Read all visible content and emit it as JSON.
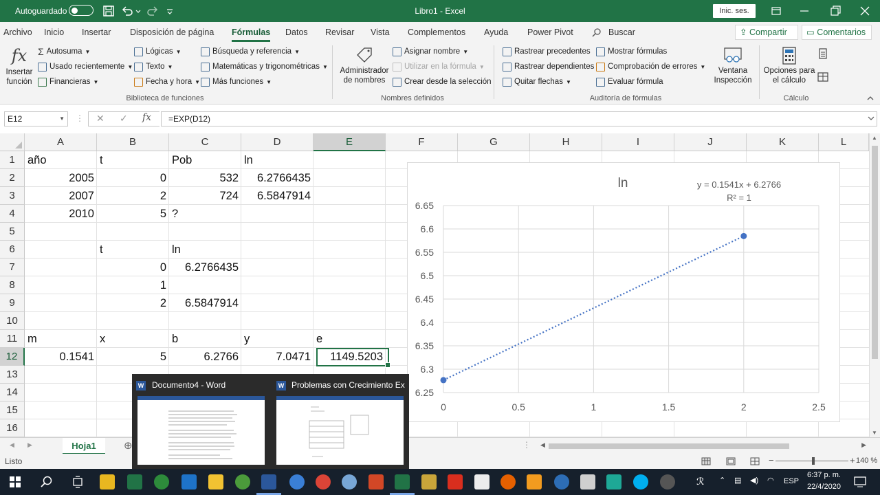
{
  "titlebar": {
    "autosave_label": "Autoguardado",
    "title": "Libro1 - Excel",
    "signin_label": "Inic. ses."
  },
  "ribbon_tabs": [
    "Archivo",
    "Inicio",
    "Insertar",
    "Disposición de página",
    "Fórmulas",
    "Datos",
    "Revisar",
    "Vista",
    "Complementos",
    "Ayuda",
    "Power Pivot"
  ],
  "search_label": "Buscar",
  "share_label": "Compartir",
  "comments_label": "Comentarios",
  "ribbon": {
    "insert_function": "Insertar\nfunción",
    "autosum": "Autosuma",
    "recent": "Usado recientemente",
    "financial": "Financieras",
    "logical": "Lógicas",
    "text": "Texto",
    "datetime": "Fecha y hora",
    "lookup": "Búsqueda y referencia",
    "math": "Matemáticas y trigonométricas",
    "more": "Más funciones",
    "group_library": "Biblioteca de funciones",
    "name_manager": "Administrador\nde nombres",
    "define_name": "Asignar nombre",
    "use_in_formula": "Utilizar en la fórmula",
    "create_from_selection": "Crear desde la selección",
    "group_names": "Nombres definidos",
    "trace_precedents": "Rastrear precedentes",
    "trace_dependents": "Rastrear dependientes",
    "remove_arrows": "Quitar flechas",
    "show_formulas": "Mostrar fórmulas",
    "error_checking": "Comprobación de errores",
    "evaluate_formula": "Evaluar fórmula",
    "watch_window": "Ventana\nInspección",
    "group_audit": "Auditoría de fórmulas",
    "calc_options": "Opciones para\nel cálculo",
    "group_calc": "Cálculo"
  },
  "formula_bar": {
    "name_box": "E12",
    "formula": "=EXP(D12)"
  },
  "columns": [
    "A",
    "B",
    "C",
    "D",
    "E",
    "F",
    "G",
    "H",
    "I",
    "J",
    "K",
    "L"
  ],
  "rows": [
    "1",
    "2",
    "3",
    "4",
    "5",
    "6",
    "7",
    "8",
    "9",
    "10",
    "11",
    "12",
    "13",
    "14",
    "15",
    "16"
  ],
  "cells": [
    {
      "ref": "A1",
      "v": "año"
    },
    {
      "ref": "B1",
      "v": "t"
    },
    {
      "ref": "C1",
      "v": "Pob"
    },
    {
      "ref": "D1",
      "v": "ln"
    },
    {
      "ref": "A2",
      "v": "2005"
    },
    {
      "ref": "B2",
      "v": "0"
    },
    {
      "ref": "C2",
      "v": "532"
    },
    {
      "ref": "D2",
      "v": "6.2766435"
    },
    {
      "ref": "A3",
      "v": "2007"
    },
    {
      "ref": "B3",
      "v": "2"
    },
    {
      "ref": "C3",
      "v": "724"
    },
    {
      "ref": "D3",
      "v": "6.5847914"
    },
    {
      "ref": "A4",
      "v": "2010"
    },
    {
      "ref": "B4",
      "v": "5"
    },
    {
      "ref": "C4",
      "v": "?"
    },
    {
      "ref": "B6",
      "v": "t"
    },
    {
      "ref": "C6",
      "v": "ln"
    },
    {
      "ref": "B7",
      "v": "0"
    },
    {
      "ref": "C7",
      "v": "6.2766435"
    },
    {
      "ref": "B8",
      "v": "1"
    },
    {
      "ref": "B9",
      "v": "2"
    },
    {
      "ref": "C9",
      "v": "6.5847914"
    },
    {
      "ref": "A11",
      "v": "m"
    },
    {
      "ref": "B11",
      "v": "x"
    },
    {
      "ref": "C11",
      "v": "b"
    },
    {
      "ref": "D11",
      "v": "y"
    },
    {
      "ref": "E11",
      "v": "e"
    },
    {
      "ref": "A12",
      "v": "0.1541"
    },
    {
      "ref": "B12",
      "v": "5"
    },
    {
      "ref": "C12",
      "v": "6.2766"
    },
    {
      "ref": "D12",
      "v": "7.0471"
    },
    {
      "ref": "E12",
      "v": "1149.5203"
    }
  ],
  "chart_data": {
    "type": "scatter",
    "title": "ln",
    "series": [
      {
        "x": [
          0,
          2
        ],
        "y": [
          6.2766435,
          6.5847914
        ]
      }
    ],
    "trendline": {
      "type": "linear",
      "slope": 0.1541,
      "intercept": 6.2766,
      "equation": "y = 0.1541x + 6.2766",
      "r2": "R² = 1"
    },
    "xlim": [
      0,
      2.5
    ],
    "ylim": [
      6.25,
      6.65
    ],
    "xticks": [
      "0",
      "0.5",
      "1",
      "1.5",
      "2",
      "2.5"
    ],
    "yticks": [
      "6.25",
      "6.3",
      "6.35",
      "6.4",
      "6.45",
      "6.5",
      "6.55",
      "6.6",
      "6.65"
    ],
    "grid": true,
    "color": "#4472c4"
  },
  "sheet_tab": "Hoja1",
  "status": "Listo",
  "zoom": "140 %",
  "preview": {
    "word_title": "Documento4 - Word",
    "other_title": "Problemas con Crecimiento Ex..."
  },
  "taskbar": {
    "lang": "ESP",
    "time": "6:37 p. m.",
    "date": "22/4/2020"
  }
}
